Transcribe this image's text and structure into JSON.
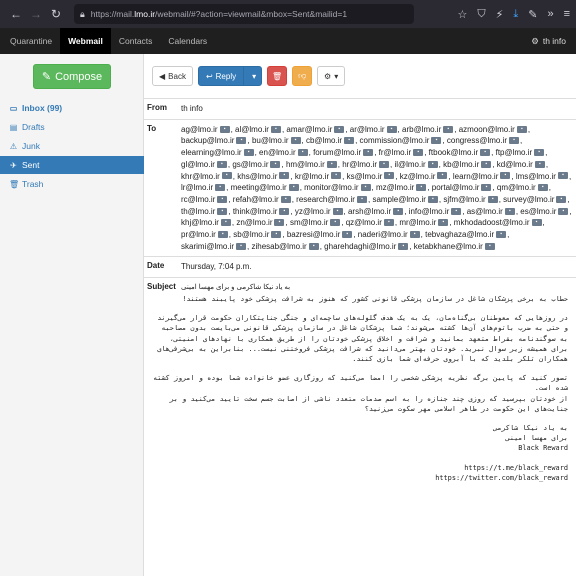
{
  "browser": {
    "url_prefix": "https://mail.",
    "url_host": "lmo.ir",
    "url_rest": "/webmail/#?action=viewmail&mbox=Sent&mailid=1"
  },
  "topnav": {
    "tabs": [
      "Quarantine",
      "Webmail",
      "Contacts",
      "Calendars"
    ],
    "active": "Webmail",
    "user": "th info"
  },
  "sidebar": {
    "compose": "Compose",
    "folders": [
      {
        "label": "Inbox (99)",
        "icon": "inbox-icon"
      },
      {
        "label": "Drafts",
        "icon": "drafts-icon"
      },
      {
        "label": "Junk",
        "icon": "junk-icon"
      },
      {
        "label": "Sent",
        "icon": "send-icon"
      },
      {
        "label": "Trash",
        "icon": "trash-icon"
      }
    ]
  },
  "toolbar": {
    "back": "Back",
    "reply": "Reply"
  },
  "message": {
    "from_label": "From",
    "from": "th info",
    "to_label": "To",
    "to": [
      "ag@lmo.ir",
      "al@lmo.ir",
      "amar@lmo.ir",
      "ar@lmo.ir",
      "arb@lmo.ir",
      "azmoon@lmo.ir",
      "backup@lmo.ir",
      "bu@lmo.ir",
      "cb@lmo.ir",
      "commission@lmo.ir",
      "congress@lmo.ir",
      "elearning@lmo.ir",
      "en@lmo.ir",
      "forum@lmo.ir",
      "fr@lmo.ir",
      "ftbook@lmo.ir",
      "ftp@lmo.ir",
      "gl@lmo.ir",
      "gs@lmo.ir",
      "hm@lmo.ir",
      "hr@lmo.ir",
      "il@lmo.ir",
      "kb@lmo.ir",
      "kd@lmo.ir",
      "khr@lmo.ir",
      "khs@lmo.ir",
      "kr@lmo.ir",
      "ks@lmo.ir",
      "kz@lmo.ir",
      "learn@lmo.ir",
      "lms@lmo.ir",
      "lr@lmo.ir",
      "meeting@lmo.ir",
      "monitor@lmo.ir",
      "mz@lmo.ir",
      "portal@lmo.ir",
      "qm@lmo.ir",
      "rc@lmo.ir",
      "refah@lmo.ir",
      "research@lmo.ir",
      "sample@lmo.ir",
      "sjfm@lmo.ir",
      "survey@lmo.ir",
      "th@lmo.ir",
      "think@lmo.ir",
      "yz@lmo.ir",
      "arsh@lmo.ir",
      "info@lmo.ir",
      "as@lmo.ir",
      "es@lmo.ir",
      "khj@lmo.ir",
      "zn@lmo.ir",
      "sm@lmo.ir",
      "qz@lmo.ir",
      "mr@lmo.ir",
      "mkhodadoost@lmo.ir",
      "pr@lmo.ir",
      "sb@lmo.ir",
      "bazresi@lmo.ir",
      "naderi@lmo.ir",
      "tebvaghaza@lmo.ir",
      "skarimi@lmo.ir",
      "zihesab@lmo.ir",
      "gharehdaghi@lmo.ir",
      "ketabkhane@lmo.ir"
    ],
    "date_label": "Date",
    "date": "Thursday, 7:04 p.m.",
    "subject_label": "Subject",
    "subject": "به یاد نیکا شاکرمی و برای مهسا امینی",
    "body": [
      "حطاب به برخی پزشکان شاغل در سازمان پزشکی قانونی کشور که هنوز به شرافت پزشکی خود پایبند هستند!",
      "در روزهایی که معوطنان بی‌گناه‌مان، یک به یک هدف گلوله‌های ساچمه‌ای و جنگی جنایتکاران حکومت قرار می‌گیرند و حتی به ضرب باتوم‌های آن‌ها کشته می‌شوند؛ شما پزشکان شاغل در سازمان پزشکی قانونی می‌بایست بدون مصاحبه به سوگندنامه بقراط متعهد بمانید و شرافت و اخلاق پزشکی خودتان را از طریق همکاری با نهادهای امنیتی، برای همیشه زیر سوال نبرید. خودتان بهتر می‌دانید که شرافت پزشکی فروختنی نیست... بنابراین به بی‌شرفی‌های همکاران تلکر بلدید که با آبروی حرفه‌ای شما بازی کنند.",
      "تصور کنید که پایین برگه نظریه پزشکی شخصی را امضا می‌کنید که روزگاری عضو خانواده شما بوده و امروز کشته شده است.\nاز خودتان بپرسید که روزی چند جنازه را به اسم صدمات متعدد ناشی از اصابت جسم سخت تایید می‌کنید و بر جنایت‌های این حکومت در ظاهر اسلامی مهر سکوت می‌زنید؟",
      "به یاد نیکا شاکرمی\nبرای مهسا امینی\nBlack Reward",
      "https://t.me/black_reward\nhttps://twitter.com/black_reward"
    ]
  },
  "colors": {
    "compose": "#5cb85c",
    "primary": "#337ab7",
    "danger": "#d9534f",
    "warning": "#f0ad4e"
  }
}
